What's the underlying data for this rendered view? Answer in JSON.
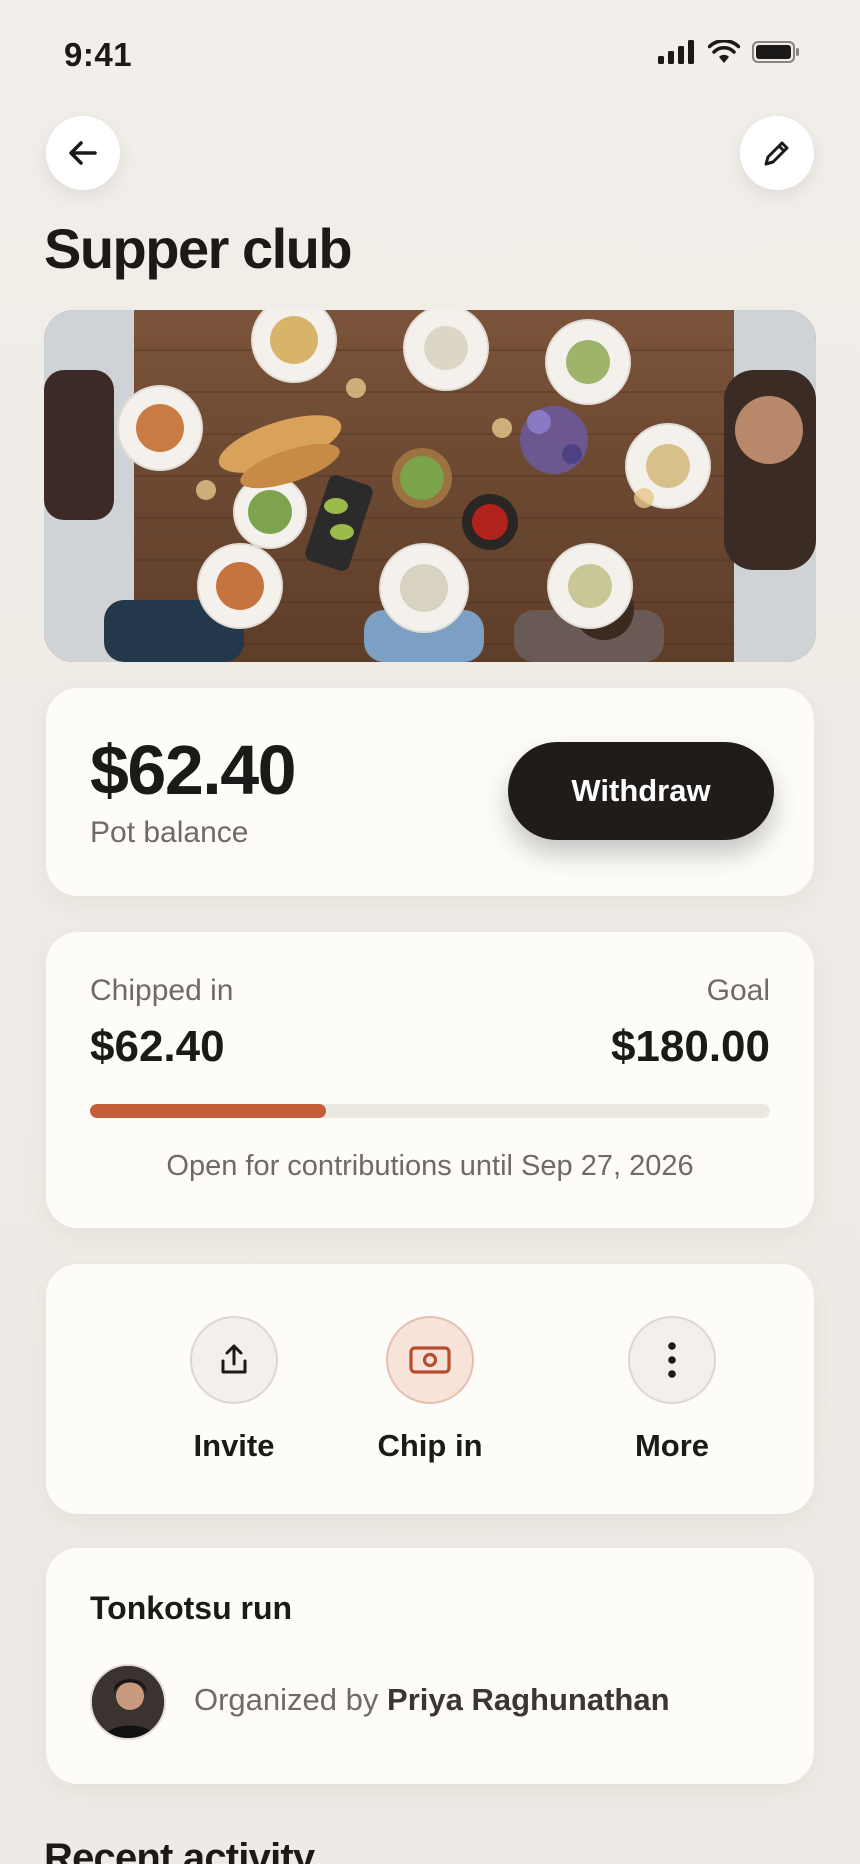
{
  "status_bar": {
    "time": "9:41"
  },
  "header": {
    "title": "Supper club"
  },
  "hero": {
    "alt": "Overhead view of a shared dinner table"
  },
  "balance": {
    "amount": "$62.40",
    "label": "Pot balance",
    "withdraw_label": "Withdraw"
  },
  "progress": {
    "chipped_label": "Chipped in",
    "chipped_amount": "$62.40",
    "goal_label": "Goal",
    "goal_amount": "$180.00",
    "fraction": 0.347,
    "deadline": "Open for contributions until Sep 27, 2026"
  },
  "actions": [
    {
      "label": "Invite",
      "icon": "share-icon"
    },
    {
      "label": "Chip in",
      "icon": "cash-icon"
    },
    {
      "label": "More",
      "icon": "more-vertical-icon"
    }
  ],
  "organizer": {
    "title": "Tonkotsu run",
    "prefix": "Organized by",
    "name": "Priya Raghunathan"
  },
  "recent_activity": {
    "title": "Recent activity"
  },
  "colors": {
    "accent": "#c55d3b",
    "button_dark": "#1f1c1a",
    "background": "#efebe6",
    "card": "#fdfcf9"
  }
}
